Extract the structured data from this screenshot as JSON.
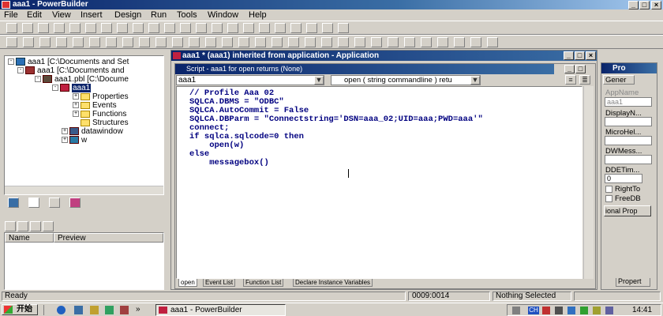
{
  "window": {
    "title": "aaa1 - PowerBuilder",
    "min": "_",
    "max": "□",
    "close": "×"
  },
  "menu": [
    "File",
    "Edit",
    "View",
    "Insert",
    "Design",
    "Run",
    "Tools",
    "Window",
    "Help"
  ],
  "tree": {
    "root": "aaa1 [C:\\Documents and Set",
    "target": "aaa1 [C:\\Documents and",
    "pbl": "aaa1.pbl [C:\\Docume",
    "app": "aaa1",
    "children": [
      "Properties",
      "Events",
      "Functions",
      "Structures"
    ],
    "datawindow": "datawindow",
    "w": "w"
  },
  "preview": {
    "col_name": "Name",
    "col_preview": "Preview"
  },
  "editor": {
    "title": "aaa1 * (aaa1) inherited from application - Application",
    "script_title": "Script - aaa1 for open returns (None)",
    "object_select": "aaa1",
    "event_select": "open ( string commandline ) retu",
    "code": [
      "// Profile Aaa 02",
      "SQLCA.DBMS = \"ODBC\"",
      "SQLCA.AutoCommit = False",
      "SQLCA.DBParm = \"Connectstring='DSN=aaa_02;UID=aaa;PWD=aaa'\"",
      "connect;",
      "if sqlca.sqlcode=0 then",
      "    open(w)",
      "else",
      "    messagebox()"
    ],
    "tabs": [
      "open",
      "Event List",
      "Function List",
      "Declare Instance Variables"
    ]
  },
  "props": {
    "title": "Pro",
    "tab": "Gener",
    "appname_label": "AppName",
    "appname_value": "aaa1",
    "display_label": "DisplayN...",
    "microhelp_label": "MicroHel...",
    "dwmessage_label": "DWMess...",
    "ddetime_label": "DDETim...",
    "ddetime_value": "0",
    "righttoleft": "RightTo",
    "freedb": "FreeDB",
    "optional_btn": "ional Prop",
    "bottom_tab": "Propert"
  },
  "status": {
    "ready": "Ready",
    "pos": "0009:0014",
    "sel": "Nothing Selected"
  },
  "taskbar": {
    "start": "开始",
    "task": "aaa1 - PowerBuilder",
    "clock": "14:41",
    "lang": "CH"
  }
}
